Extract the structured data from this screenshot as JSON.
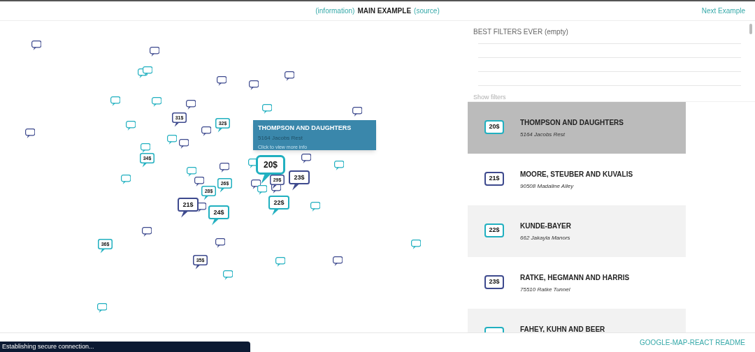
{
  "header": {
    "info_link": "(information)",
    "title": "MAIN EXAMPLE",
    "source_link": "(source)",
    "next_link": "Next Example"
  },
  "map": {
    "markers": [
      {
        "kind": "small",
        "color": "#3e4a8e"
      },
      {
        "kind": "small",
        "color": "#3e4a8e"
      },
      {
        "kind": "small",
        "color": "#21b0c0"
      },
      {
        "kind": "small",
        "color": "#21b0c0"
      },
      {
        "kind": "small",
        "color": "#3e4a8e"
      },
      {
        "kind": "small",
        "color": "#3e4a8e"
      },
      {
        "kind": "small",
        "color": "#3e4a8e"
      },
      {
        "kind": "small",
        "color": "#21b0c0"
      },
      {
        "kind": "small",
        "color": "#21b0c0"
      },
      {
        "kind": "small",
        "color": "#3e4a8e"
      },
      {
        "kind": "small",
        "color": "#21b0c0"
      },
      {
        "kind": "small",
        "color": "#3e4a8e"
      },
      {
        "kind": "small",
        "color": "#3e4a8e"
      },
      {
        "kind": "small",
        "color": "#21b0c0"
      },
      {
        "kind": "small",
        "color": "#3e4a8e"
      },
      {
        "kind": "small",
        "color": "#21b0c0"
      },
      {
        "kind": "small",
        "color": "#3e4a8e"
      },
      {
        "kind": "small",
        "color": "#21b0c0"
      },
      {
        "kind": "small",
        "color": "#3e4a8e"
      },
      {
        "kind": "small",
        "color": "#21b0c0"
      },
      {
        "kind": "small",
        "color": "#21b0c0"
      },
      {
        "kind": "small",
        "color": "#3e4a8e"
      },
      {
        "kind": "small",
        "color": "#3e4a8e"
      },
      {
        "kind": "small",
        "color": "#21b0c0"
      },
      {
        "kind": "small",
        "color": "#21b0c0"
      },
      {
        "kind": "small",
        "color": "#3e4a8e"
      },
      {
        "kind": "small",
        "color": "#21b0c0"
      },
      {
        "kind": "small",
        "color": "#3e4a8e"
      },
      {
        "kind": "small",
        "color": "#3e4a8e"
      },
      {
        "kind": "small",
        "color": "#21b0c0"
      },
      {
        "kind": "small",
        "color": "#3e4a8e"
      },
      {
        "kind": "small",
        "color": "#3e4a8e"
      },
      {
        "kind": "small",
        "color": "#21b0c0"
      },
      {
        "kind": "small",
        "color": "#3e4a8e"
      },
      {
        "kind": "small",
        "color": "#21b0c0"
      },
      {
        "kind": "small",
        "color": "#21b0c0"
      },
      {
        "kind": "small",
        "color": "#21b0c0"
      },
      {
        "kind": "medium",
        "color": "#3e4a8e",
        "price": "31$",
        "selected": false
      },
      {
        "kind": "medium",
        "color": "#21b0c0",
        "price": "32$",
        "selected": false
      },
      {
        "kind": "medium",
        "color": "#21b0c0",
        "price": "34$",
        "selected": false
      },
      {
        "kind": "medium",
        "color": "#21b0c0",
        "price": "36$",
        "selected": false
      },
      {
        "kind": "medium",
        "color": "#3e4a8e",
        "price": "35$",
        "selected": false
      },
      {
        "kind": "medium",
        "color": "#21b0c0",
        "price": "28$",
        "selected": false
      },
      {
        "kind": "medium",
        "color": "#21b0c0",
        "price": "26$",
        "selected": false
      },
      {
        "kind": "medium",
        "color": "#3e4a8e",
        "price": "29$",
        "selected": false
      },
      {
        "kind": "large",
        "color": "#21b0c0",
        "price": "24$",
        "selected": false
      },
      {
        "kind": "large",
        "color": "#3e4a8e",
        "price": "21$",
        "selected": false
      },
      {
        "kind": "large",
        "color": "#21b0c0",
        "price": "22$",
        "selected": false
      },
      {
        "kind": "large",
        "color": "#3e4a8e",
        "price": "23$",
        "selected": false
      },
      {
        "kind": "large",
        "color": "#21b0c0",
        "price": "20$",
        "selected": true
      }
    ],
    "tooltip": {
      "name": "THOMPSON AND DAUGHTERS",
      "address": "5164 Jacobs Rest",
      "hint": "Click to view more info"
    }
  },
  "filters": {
    "title": "BEST FILTERS EVER (empty)",
    "toggle": "Show filters"
  },
  "places": [
    {
      "price": "20$",
      "color": "#21b0c0",
      "name": "THOMPSON AND DAUGHTERS",
      "address": "5164 Jacobs Rest",
      "selected": true
    },
    {
      "price": "21$",
      "color": "#3e4a8e",
      "name": "MOORE, STEUBER AND KUVALIS",
      "address": "90508 Madaline Alley",
      "selected": false
    },
    {
      "price": "22$",
      "color": "#21b0c0",
      "name": "KUNDE-BAYER",
      "address": "662 Jakayla Manors",
      "selected": false
    },
    {
      "price": "23$",
      "color": "#3e4a8e",
      "name": "RATKE, HEGMANN AND HARRIS",
      "address": "75510 Ratke Tunnel",
      "selected": false
    },
    {
      "color": "#21b0c0",
      "name": "FAHEY, KUHN AND BEER",
      "selected": false
    }
  ],
  "footer": {
    "readme_link": "GOOGLE-MAP-REACT README"
  },
  "status_bar": "Establishing secure connection..."
}
